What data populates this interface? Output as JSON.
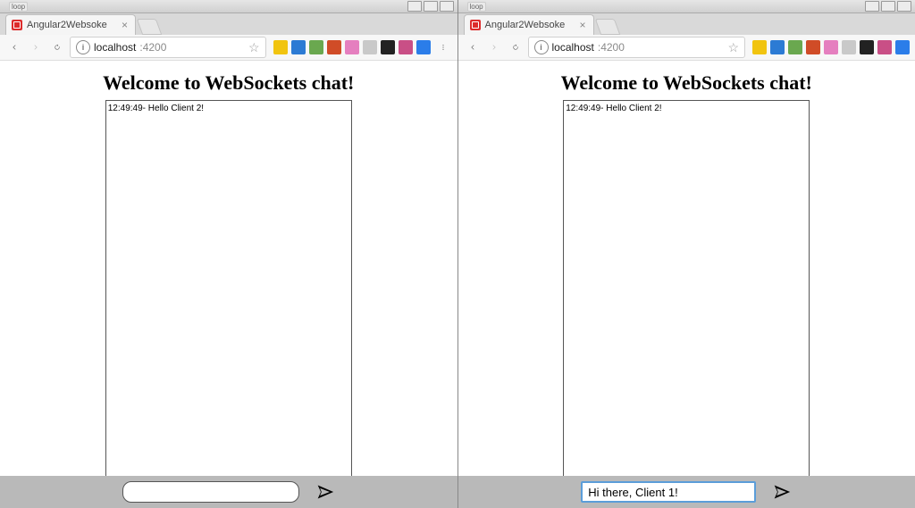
{
  "windows": [
    {
      "titlebar_label": "loop",
      "tab_title": "Angular2Websoke",
      "url_host": "localhost",
      "url_path": ":4200",
      "page_heading": "Welcome to WebSockets chat!",
      "messages": [
        "12:49:49- Hello Client 2!"
      ],
      "composer_value": "",
      "composer_focused": false
    },
    {
      "titlebar_label": "loop",
      "tab_title": "Angular2Websoke",
      "url_host": "localhost",
      "url_path": ":4200",
      "page_heading": "Welcome to WebSockets chat!",
      "messages": [
        "12:49:49- Hello Client 2!"
      ],
      "composer_value": "Hi there, Client 1!",
      "composer_focused": true
    }
  ],
  "extension_colors": [
    "#f1c40f",
    "#2c7bd4",
    "#6aa84f",
    "#d04c27",
    "#e57fbf",
    "#c9c9c9",
    "#222222",
    "#c94f86",
    "#2b7de9"
  ]
}
